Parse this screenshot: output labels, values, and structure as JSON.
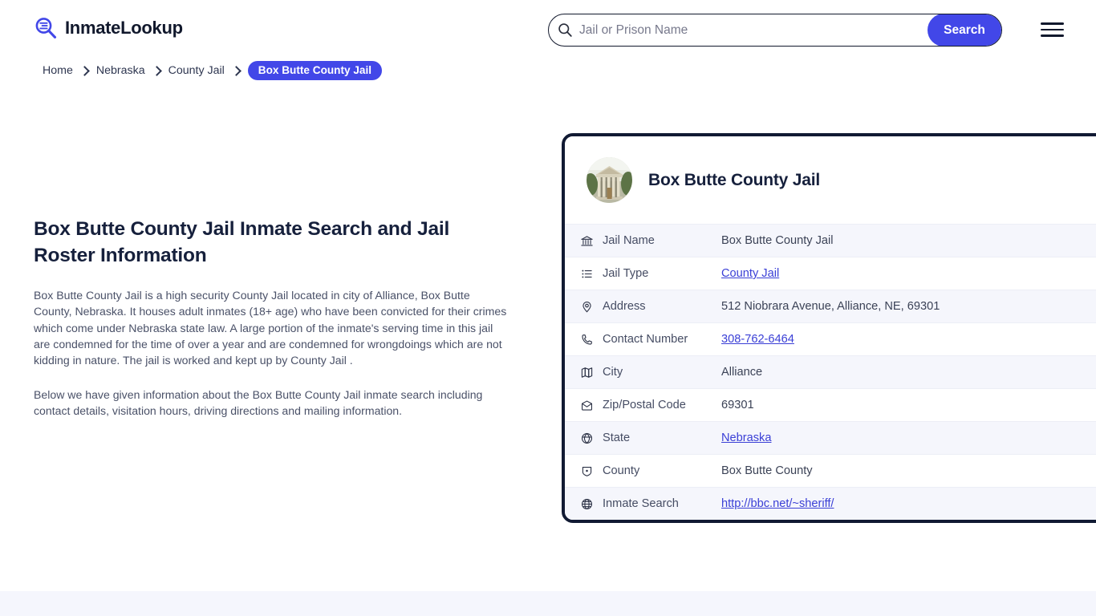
{
  "header": {
    "brand_name": "InmateLookup",
    "brand_icon": "magnifier-list-icon",
    "search": {
      "icon": "search-icon",
      "placeholder": "Jail or Prison Name",
      "value": "",
      "button_label": "Search"
    },
    "menu_icon": "hamburger-menu-icon"
  },
  "breadcrumb": {
    "items": [
      {
        "label": "Home"
      },
      {
        "label": "Nebraska"
      },
      {
        "label": "County Jail"
      }
    ],
    "active": "Box Butte County Jail"
  },
  "main": {
    "title": "Box Butte County Jail Inmate Search and Jail Roster Information",
    "paragraph_1": "Box Butte County Jail is a high security County Jail located in city of Alliance, Box Butte County, Nebraska. It houses adult inmates (18+ age) who have been convicted for their crimes which come under Nebraska state law. A large portion of the inmate's serving time in this jail are condemned for the time of over a year and are condemned for wrongdoings which are not kidding in nature. The jail is worked and kept up by County Jail .",
    "paragraph_2": "Below we have given information about the Box Butte County Jail inmate search including contact details, visitation hours, driving directions and mailing information."
  },
  "card": {
    "avatar_icon": "courthouse-photo",
    "title": "Box Butte County Jail",
    "rows": [
      {
        "icon": "bank-icon",
        "label": "Jail Name",
        "value": "Box Butte County Jail",
        "link": false
      },
      {
        "icon": "list-icon",
        "label": "Jail Type",
        "value": "County Jail",
        "link": true
      },
      {
        "icon": "map-pin-icon",
        "label": "Address",
        "value": "512 Niobrara Avenue, Alliance, NE, 69301",
        "link": false
      },
      {
        "icon": "phone-icon",
        "label": "Contact Number",
        "value": "308-762-6464",
        "link": true
      },
      {
        "icon": "map-icon",
        "label": "City",
        "value": "Alliance",
        "link": false
      },
      {
        "icon": "envelope-icon",
        "label": "Zip/Postal Code",
        "value": "69301",
        "link": false
      },
      {
        "icon": "globe-icon",
        "label": "State",
        "value": "Nebraska",
        "link": true
      },
      {
        "icon": "badge-icon",
        "label": "County",
        "value": "Box Butte County",
        "link": false
      },
      {
        "icon": "world-icon",
        "label": "Inmate Search",
        "value": "http://bbc.net/~sheriff/",
        "link": true
      }
    ]
  },
  "colors": {
    "accent_blue": "#4247e8",
    "link_blue": "#3a3fd6",
    "dark_navy": "#111a33",
    "row_alt": "#f5f6fc",
    "band": "#f5f6fd"
  }
}
